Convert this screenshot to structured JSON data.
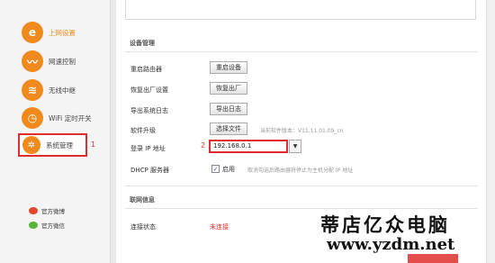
{
  "sidebar": {
    "items": [
      {
        "label": "上网设置",
        "icon": "e-globe-icon",
        "glyph": "e"
      },
      {
        "label": "网速控制",
        "icon": "speed-wave-icon",
        "glyph": "〰"
      },
      {
        "label": "无线中继",
        "icon": "wireless-relay-icon",
        "glyph": "≋"
      },
      {
        "label": "WiFi 定时开关",
        "icon": "timer-icon",
        "glyph": "◷"
      },
      {
        "label": "系统管理",
        "icon": "gear-icon",
        "glyph": "✲"
      }
    ],
    "active_marker": "1",
    "social": [
      {
        "label": "官方微博",
        "icon": "weibo-icon"
      },
      {
        "label": "官方微信",
        "icon": "wechat-icon"
      }
    ]
  },
  "main": {
    "device_section_title": "设备管理",
    "rows": {
      "reboot": {
        "label": "重启路由器",
        "button": "重启设备"
      },
      "factory": {
        "label": "恢复出厂设置",
        "button": "恢复出厂"
      },
      "export_log": {
        "label": "导出系统日志",
        "button": "导出日志"
      },
      "upgrade": {
        "label": "软件升级",
        "button": "选择文件",
        "version": "当前软件版本：V11.11.01.09_cn"
      },
      "login_ip": {
        "label": "登录 IP 地址",
        "step_marker": "2",
        "value": "192.168.0.1"
      },
      "dhcp": {
        "label": "DHCP 服务器",
        "checkbox_label": "启用",
        "checked": true,
        "hint": "取消勾选后路由器将停止为主机分配 IP 地址"
      }
    },
    "network_section_title": "联网信息",
    "connection": {
      "label": "连接状态",
      "value": "未连接"
    }
  },
  "watermark": {
    "brand": "蒂店亿众电脑",
    "url": "www.yzdm.net"
  },
  "colors": {
    "accent": "#f08a1c",
    "highlight": "#e02d2d"
  }
}
